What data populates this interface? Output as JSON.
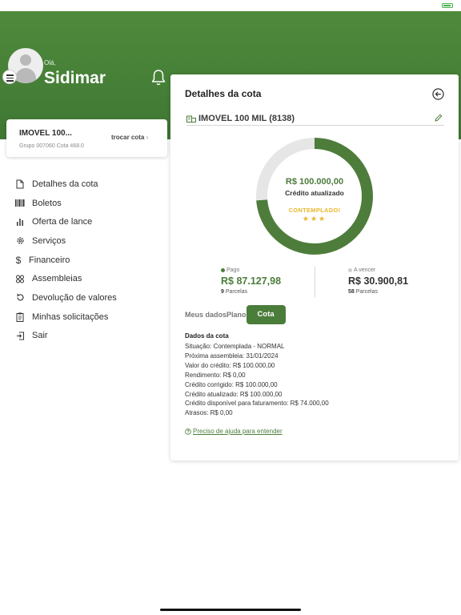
{
  "user": {
    "greeting": "Olá,",
    "name": "Sidimar"
  },
  "quota_card": {
    "name": "IMOVEL 100...",
    "group": "Grupo 007060  Cota 468.0",
    "switch_label": "trocar cota"
  },
  "menu": [
    {
      "label": "Detalhes da cota",
      "icon": "document-icon"
    },
    {
      "label": "Boletos",
      "icon": "barcode-icon"
    },
    {
      "label": "Oferta de lance",
      "icon": "bar-chart-icon"
    },
    {
      "label": "Serviços",
      "icon": "gear-icon"
    },
    {
      "label": "Financeiro",
      "icon": "dollar-icon"
    },
    {
      "label": "Assembleias",
      "icon": "group-icon"
    },
    {
      "label": "Devolução de valores",
      "icon": "refresh-icon"
    },
    {
      "label": "Minhas solicitações",
      "icon": "clipboard-icon"
    },
    {
      "label": "Sair",
      "icon": "logout-icon"
    }
  ],
  "panel": {
    "title": "Detalhes da cota",
    "asset_name": "IMOVEL 100 MIL (8138)",
    "donut": {
      "value": "R$ 100.000,00",
      "label": "Crédito atualizado",
      "status": "CONTEMPLADO!",
      "stars": "★★★",
      "paid_fraction": 0.738
    },
    "paid": {
      "label": "Pago",
      "value": "R$ 87.127,98",
      "count": "9",
      "count_label": "Parcelas"
    },
    "due": {
      "label": "A vencer",
      "value": "R$ 30.900,81",
      "count": "58",
      "count_label": "Parcelas"
    },
    "tabs": [
      "Meus dados",
      "Plano",
      "Cota"
    ],
    "details_title": "Dados da cota",
    "details": [
      "Situação: Contemplada - NORMAL",
      "Próxima assembleia: 31/01/2024",
      "Valor do crédito: R$ 100.000,00",
      "Rendimento: R$ 0,00",
      "Crédito corrigido: R$ 100.000,00",
      "Crédito atualizado: R$ 100.000,00",
      "Crédito disponível para faturamento: R$ 74.000,00",
      "Atrasos: R$ 0,00"
    ],
    "help_text": "Preciso de ajuda para entender"
  },
  "colors": {
    "brand_green": "#4b7d3a",
    "header_green": "#4f8a3c",
    "star_gold": "#e8b729",
    "donut_track": "#e6e6e6"
  }
}
